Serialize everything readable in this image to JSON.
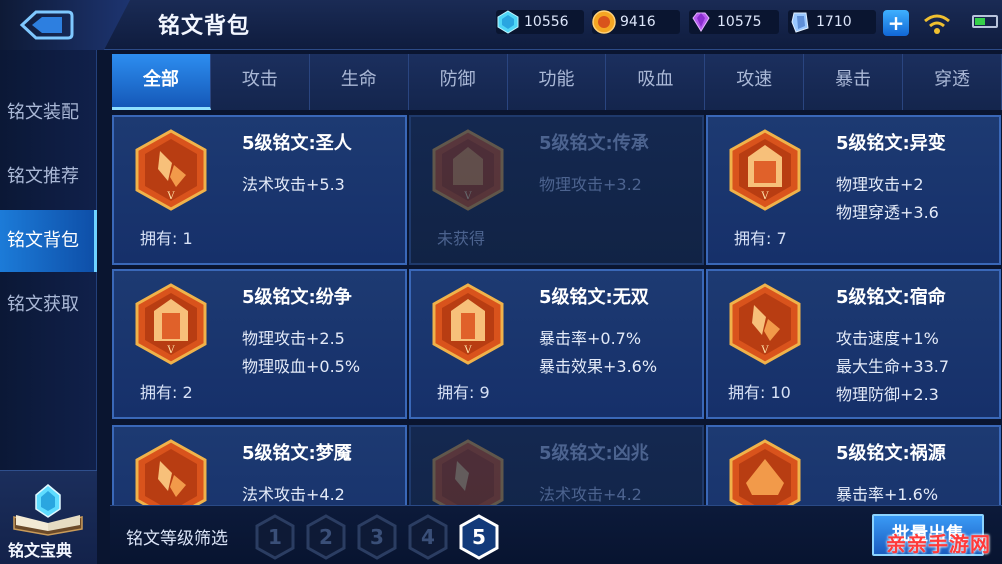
{
  "header": {
    "title": "铭文背包",
    "currencies": [
      {
        "icon": "diamond-gem-icon",
        "value": "10556"
      },
      {
        "icon": "gold-coin-icon",
        "value": "9416"
      },
      {
        "icon": "purple-crystal-icon",
        "value": "10575"
      },
      {
        "icon": "blue-shard-icon",
        "value": "1710"
      }
    ],
    "add_label": "+"
  },
  "sidebar": {
    "items": [
      {
        "label": "铭文装配"
      },
      {
        "label": "铭文推荐"
      },
      {
        "label": "铭文背包"
      },
      {
        "label": "铭文获取"
      }
    ],
    "active_index": 2,
    "codex_label": "铭文宝典"
  },
  "tabs": [
    {
      "label": "全部"
    },
    {
      "label": "攻击"
    },
    {
      "label": "生命"
    },
    {
      "label": "防御"
    },
    {
      "label": "功能"
    },
    {
      "label": "吸血"
    },
    {
      "label": "攻速"
    },
    {
      "label": "暴击"
    },
    {
      "label": "穿透"
    }
  ],
  "active_tab": 0,
  "cards": [
    {
      "name": "5级铭文:圣人",
      "stats": [
        "法术攻击+5.3"
      ],
      "owned": "拥有: 1",
      "locked": false
    },
    {
      "name": "5级铭文:传承",
      "stats": [
        "物理攻击+3.2"
      ],
      "owned": "未获得",
      "locked": true
    },
    {
      "name": "5级铭文:异变",
      "stats": [
        "物理攻击+2",
        "物理穿透+3.6"
      ],
      "owned": "拥有: 7",
      "locked": false
    },
    {
      "name": "5级铭文:纷争",
      "stats": [
        "物理攻击+2.5",
        "物理吸血+0.5%"
      ],
      "owned": "拥有: 2",
      "locked": false
    },
    {
      "name": "5级铭文:无双",
      "stats": [
        "暴击率+0.7%",
        "暴击效果+3.6%"
      ],
      "owned": "拥有: 9",
      "locked": false
    },
    {
      "name": "5级铭文:宿命",
      "stats": [
        "攻击速度+1%",
        "最大生命+33.7",
        "物理防御+2.3"
      ],
      "owned": "拥有: 10",
      "locked": false
    },
    {
      "name": "5级铭文:梦魇",
      "stats": [
        "法术攻击+4.2"
      ],
      "owned": "",
      "locked": false
    },
    {
      "name": "5级铭文:凶兆",
      "stats": [
        "法术攻击+4.2"
      ],
      "owned": "",
      "locked": true
    },
    {
      "name": "5级铭文:祸源",
      "stats": [
        "暴击率+1.6%"
      ],
      "owned": "",
      "locked": false
    }
  ],
  "filter": {
    "label": "铭文等级筛选",
    "levels": [
      "1",
      "2",
      "3",
      "4",
      "5"
    ],
    "active_level": "5",
    "bulk_sell_label": "批量出售"
  },
  "watermark": "亲亲手游网",
  "colors": {
    "accent": "#1c7bd8",
    "card_border": "#3a68b8",
    "emblem_orange": "#d9531c",
    "emblem_gold": "#f0b24a",
    "watermark_red": "#ff3b3b"
  }
}
